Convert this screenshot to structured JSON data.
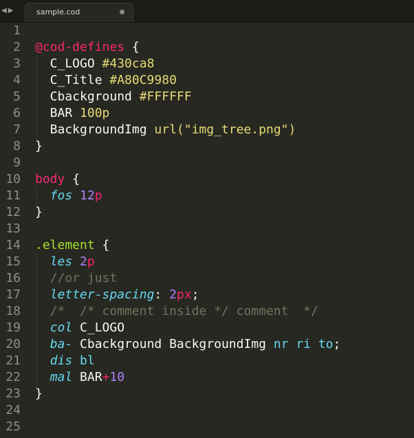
{
  "tab": {
    "filename": "sample.cod"
  },
  "nav": {
    "back": "◀",
    "forward": "▶"
  },
  "lines": [
    {
      "n": "1",
      "tokens": []
    },
    {
      "n": "2",
      "tokens": [
        {
          "t": "@cod-defines",
          "c": "at"
        },
        {
          "t": " {",
          "c": "plain"
        }
      ]
    },
    {
      "n": "3",
      "tokens": [
        {
          "t": "  C_LOGO ",
          "c": "plain"
        },
        {
          "t": "#430ca8",
          "c": "yel"
        }
      ]
    },
    {
      "n": "4",
      "tokens": [
        {
          "t": "  C_Title ",
          "c": "plain"
        },
        {
          "t": "#A80C9980",
          "c": "yel"
        }
      ]
    },
    {
      "n": "5",
      "tokens": [
        {
          "t": "  Cbackground ",
          "c": "plain"
        },
        {
          "t": "#FFFFFF",
          "c": "yel"
        }
      ]
    },
    {
      "n": "6",
      "tokens": [
        {
          "t": "  BAR ",
          "c": "plain"
        },
        {
          "t": "100p",
          "c": "yel"
        }
      ]
    },
    {
      "n": "7",
      "tokens": [
        {
          "t": "  BackgroundImg ",
          "c": "plain"
        },
        {
          "t": "url(\"img_tree.png\")",
          "c": "yel"
        }
      ]
    },
    {
      "n": "8",
      "tokens": [
        {
          "t": "}",
          "c": "plain"
        }
      ]
    },
    {
      "n": "9",
      "tokens": []
    },
    {
      "n": "10",
      "tokens": [
        {
          "t": "body",
          "c": "sel"
        },
        {
          "t": " {",
          "c": "plain"
        }
      ]
    },
    {
      "n": "11",
      "tokens": [
        {
          "t": "  ",
          "c": "plain"
        },
        {
          "t": "fos",
          "c": "prop"
        },
        {
          "t": " ",
          "c": "plain"
        },
        {
          "t": "12",
          "c": "num"
        },
        {
          "t": "p",
          "c": "unit"
        }
      ]
    },
    {
      "n": "12",
      "tokens": [
        {
          "t": "}",
          "c": "plain"
        }
      ]
    },
    {
      "n": "13",
      "tokens": []
    },
    {
      "n": "14",
      "tokens": [
        {
          "t": ".element",
          "c": "cls"
        },
        {
          "t": " {",
          "c": "plain"
        }
      ]
    },
    {
      "n": "15",
      "tokens": [
        {
          "t": "  ",
          "c": "plain"
        },
        {
          "t": "les",
          "c": "prop"
        },
        {
          "t": " ",
          "c": "plain"
        },
        {
          "t": "2",
          "c": "num"
        },
        {
          "t": "p",
          "c": "unit"
        }
      ]
    },
    {
      "n": "16",
      "tokens": [
        {
          "t": "  //or just",
          "c": "cmt"
        }
      ]
    },
    {
      "n": "17",
      "tokens": [
        {
          "t": "  ",
          "c": "plain"
        },
        {
          "t": "letter-spacing",
          "c": "prop"
        },
        {
          "t": ": ",
          "c": "plain"
        },
        {
          "t": "2",
          "c": "num"
        },
        {
          "t": "px",
          "c": "unit"
        },
        {
          "t": ";",
          "c": "plain"
        }
      ]
    },
    {
      "n": "18",
      "tokens": [
        {
          "t": "  /*  /* comment inside */ comment  */",
          "c": "cmt"
        }
      ]
    },
    {
      "n": "19",
      "tokens": [
        {
          "t": "  ",
          "c": "plain"
        },
        {
          "t": "col",
          "c": "prop"
        },
        {
          "t": " C_LOGO",
          "c": "plain"
        }
      ]
    },
    {
      "n": "20",
      "tokens": [
        {
          "t": "  ",
          "c": "plain"
        },
        {
          "t": "ba-",
          "c": "prop"
        },
        {
          "t": " Cbackground BackgroundImg ",
          "c": "plain"
        },
        {
          "t": "nr ri to",
          "c": "kw"
        },
        {
          "t": ";",
          "c": "plain"
        }
      ]
    },
    {
      "n": "21",
      "tokens": [
        {
          "t": "  ",
          "c": "plain"
        },
        {
          "t": "dis",
          "c": "prop"
        },
        {
          "t": " ",
          "c": "plain"
        },
        {
          "t": "bl",
          "c": "kw"
        }
      ]
    },
    {
      "n": "22",
      "tokens": [
        {
          "t": "  ",
          "c": "plain"
        },
        {
          "t": "mal",
          "c": "prop"
        },
        {
          "t": " BAR",
          "c": "plain"
        },
        {
          "t": "+",
          "c": "unit"
        },
        {
          "t": "10",
          "c": "num"
        }
      ]
    },
    {
      "n": "23",
      "tokens": [
        {
          "t": "}",
          "c": "plain"
        }
      ]
    },
    {
      "n": "24",
      "tokens": []
    },
    {
      "n": "25",
      "tokens": []
    }
  ]
}
